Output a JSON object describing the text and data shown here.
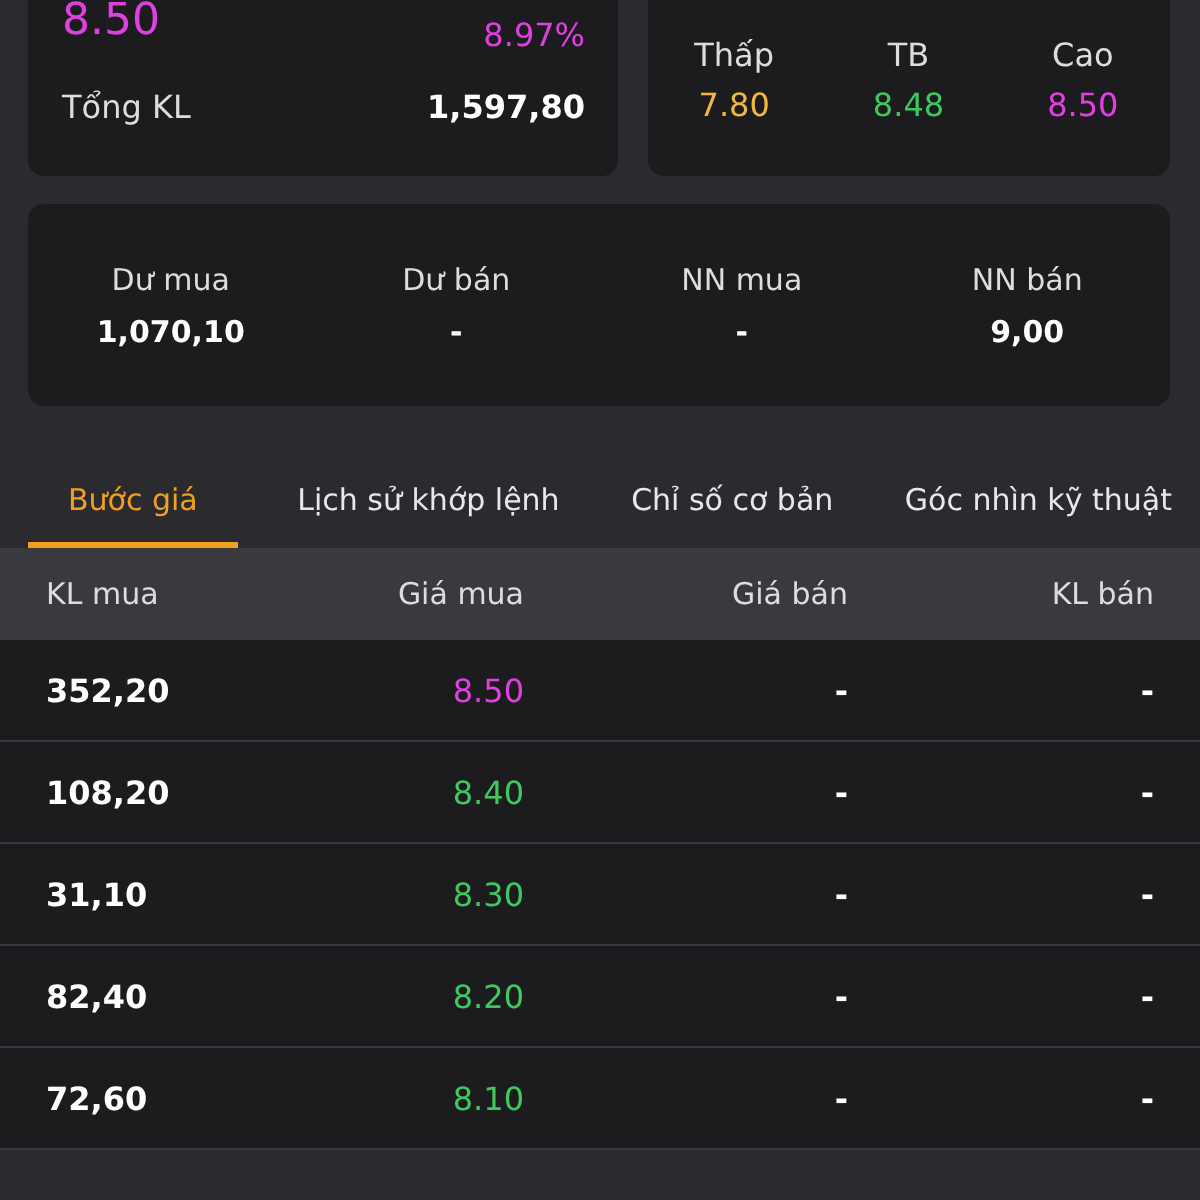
{
  "summary": {
    "price": {
      "text": "8.50",
      "color": "#e040e0"
    },
    "change_pct": {
      "text": "8.97%",
      "color": "#e040e0"
    },
    "total_volume_label": "Tổng KL",
    "total_volume": "1,597,80"
  },
  "range": [
    {
      "label": "Thấp",
      "value": "7.80",
      "color": "#f0b840"
    },
    {
      "label": "TB",
      "value": "8.48",
      "color": "#3fc860"
    },
    {
      "label": "Cao",
      "value": "8.50",
      "color": "#e040e0"
    }
  ],
  "balances": [
    {
      "label": "Dư mua",
      "value": "1,070,10"
    },
    {
      "label": "Dư bán",
      "value": "-"
    },
    {
      "label": "NN mua",
      "value": "-"
    },
    {
      "label": "NN bán",
      "value": "9,00"
    }
  ],
  "tabs": [
    {
      "label": "Bước giá",
      "selected": true
    },
    {
      "label": "Lịch sử khớp lệnh",
      "selected": false
    },
    {
      "label": "Chỉ số cơ bản",
      "selected": false
    },
    {
      "label": "Góc nhìn kỹ thuật",
      "selected": false
    }
  ],
  "table": {
    "columns": [
      "KL mua",
      "Giá mua",
      "Giá bán",
      "KL bán"
    ],
    "rows": [
      {
        "buy_volume": "352,20",
        "buy_price": "8.50",
        "color": "#e040e0",
        "sell_price": "-",
        "sell_volume": "-"
      },
      {
        "buy_volume": "108,20",
        "buy_price": "8.40",
        "color": "#3fc860",
        "sell_price": "-",
        "sell_volume": "-"
      },
      {
        "buy_volume": "31,10",
        "buy_price": "8.30",
        "color": "#3fc860",
        "sell_price": "-",
        "sell_volume": "-"
      },
      {
        "buy_volume": "82,40",
        "buy_price": "8.20",
        "color": "#3fc860",
        "sell_price": "-",
        "sell_volume": "-"
      },
      {
        "buy_volume": "72,60",
        "buy_price": "8.10",
        "color": "#3fc860",
        "sell_price": "-",
        "sell_volume": "-"
      }
    ]
  }
}
